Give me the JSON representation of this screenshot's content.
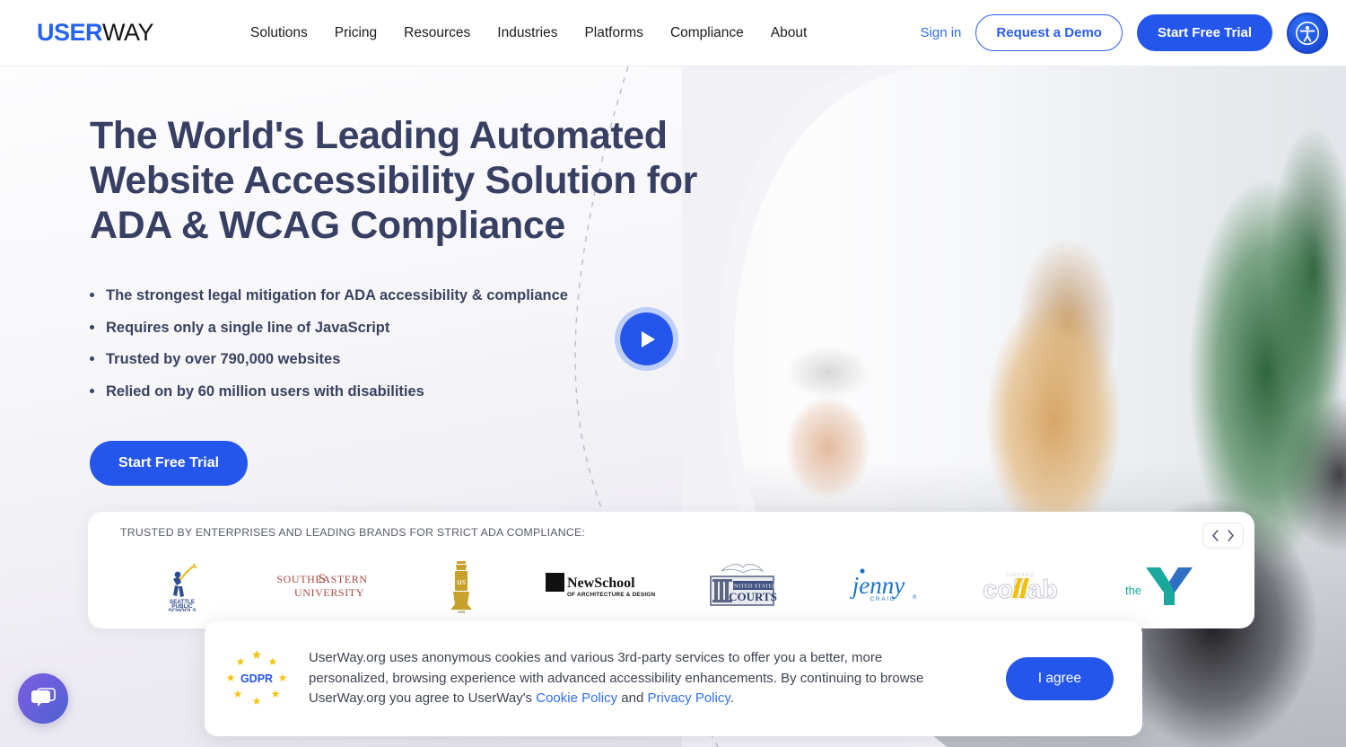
{
  "brand": {
    "logo_primary": "USER",
    "logo_secondary": "WAY",
    "accent_blue": "#2556ec",
    "headline_navy": "#373f63"
  },
  "header": {
    "nav": [
      {
        "label": "Solutions"
      },
      {
        "label": "Pricing"
      },
      {
        "label": "Resources"
      },
      {
        "label": "Industries"
      },
      {
        "label": "Platforms"
      },
      {
        "label": "Compliance"
      },
      {
        "label": "About"
      }
    ],
    "sign_in": "Sign in",
    "request_demo": "Request a Demo",
    "start_free_trial": "Start Free Trial",
    "accessibility_widget_icon": "accessibility-person-icon"
  },
  "hero": {
    "headline": "The World's Leading Automated Website Accessibility Solution for ADA & WCAG Compliance",
    "bullets": [
      "The strongest legal mitigation for ADA accessibility & compliance",
      "Requires only a single line of JavaScript",
      "Trusted by over 790,000 websites",
      "Relied on by 60 million users with disabilities"
    ],
    "cta": "Start Free Trial",
    "play_button_icon": "play-icon"
  },
  "trusted": {
    "label": "TRUSTED BY ENTERPRISES AND LEADING BRANDS FOR STRICT ADA COMPLIANCE:",
    "logos": [
      {
        "name": "Seattle Public Schools",
        "line1": "SEATTLE",
        "line2": "PUBLIC",
        "line3": "SCHOOLS"
      },
      {
        "name": "Southeastern University",
        "line1": "SOUTHEASTERN",
        "line2": "UNIVERSITY"
      },
      {
        "name": "University of Southern Mississippi",
        "line1": "usp"
      },
      {
        "name": "NewSchool of Architecture & Design",
        "line1": "NewSchool",
        "line2": "OF ARCHITECTURE & DESIGN"
      },
      {
        "name": "United States Courts",
        "line1": "UNITED STATES",
        "line2": "COURTS"
      },
      {
        "name": "Jenny Craig",
        "line1": "jenny",
        "line2": "CRAIG"
      },
      {
        "name": "Chicago Collab",
        "line1": "collab",
        "line2": "CHICAGO"
      },
      {
        "name": "The Y / YMCA",
        "line1": "the",
        "line2": "Y"
      }
    ],
    "prev_icon": "chevron-left-icon",
    "next_icon": "chevron-right-icon"
  },
  "cookie": {
    "gdpr_badge": "GDPR",
    "text_part1": "UserWay.org uses anonymous cookies and various 3rd-party services to offer you a better, more personalized, browsing experience with advanced accessibility enhancements. By continuing to browse UserWay.org you agree to UserWay's ",
    "link_cookie_policy": "Cookie Policy",
    "text_and": " and ",
    "link_privacy_policy": "Privacy Policy",
    "text_end": ".",
    "agree_button": "I agree"
  },
  "chat": {
    "icon": "chat-bubbles-icon"
  }
}
